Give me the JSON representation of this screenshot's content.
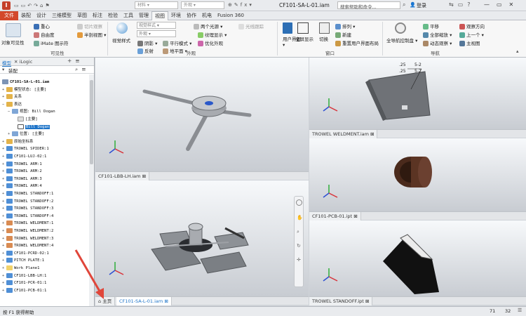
{
  "title": {
    "filename": "CF101-SA-L-01.iam",
    "search_placeholder": "搜索帮助和命令...",
    "login": "登录"
  },
  "ribbon_tabs": [
    "文件",
    "装配",
    "设计",
    "三维模型",
    "草图",
    "标注",
    "检验",
    "工具",
    "管理",
    "视图",
    "环境",
    "协作",
    "机电",
    "Fusion 360"
  ],
  "ribbon": {
    "visibility": {
      "big": "对象可见性",
      "center": "重心",
      "dof": "自由度",
      "imate": "iMate 图示符",
      "halfsection": "半剖视图",
      "slice": "切片观察",
      "panel": "可见性"
    },
    "appearance": {
      "visual_style": "视觉样式",
      "style_dd": "视觉样式",
      "appear_dd": "外观",
      "shadow": "阴影",
      "reflect": "反射",
      "parallel": "平行模式",
      "ground": "地平面",
      "lights": "两个光源",
      "texture": "纹理显示",
      "optimize": "优化外观",
      "raytrace": "光线跟踪",
      "panel": "外观"
    },
    "window": {
      "ui": "用户界面",
      "fullscreen": "全屏显示",
      "switch": "切换",
      "arrange": "排列",
      "new": "新建",
      "reset": "重置用户界面布局",
      "panel": "窗口"
    },
    "nav": {
      "bar": "全导航控制盘",
      "pan": "平移",
      "zoomall": "全部缩放",
      "orbit": "动态观察",
      "viewface": "观察方向",
      "prev": "上一个",
      "home": "主视图",
      "panel": "导航"
    }
  },
  "browser": {
    "tabs": [
      "模型",
      "iLogic"
    ],
    "header": "装配",
    "items": [
      "CF101-SA-L-01.iam",
      "模型状态: [主要]",
      "关系",
      "表达",
      "视图: Bill Dogan",
      "[主要]",
      "Bill Dogan",
      "位置: [主要]",
      "原始坐标系",
      "TROWEL SPIDER:1",
      "CF101-LUJ-02:1",
      "TROWEL ARM:1",
      "TROWEL ARM:2",
      "TROWEL ARM:3",
      "TROWEL ARM:4",
      "TROWEL STANDOFF:1",
      "TROWEL STANDOFF:2",
      "TROWEL STANDOFF:3",
      "TROWEL STANDOFF:4",
      "TROWEL WELDMENT:1",
      "TROWEL WELDMENT:2",
      "TROWEL WELDMENT:3",
      "TROWEL WELDMENT:4",
      "CF101-PCRD-02:1",
      "PITCH PLATE:1",
      "Work Plane1",
      "CF101-LBB-LH:1",
      "CF101-PCR-01:1",
      "CF101-PCB-01:1"
    ]
  },
  "viewports": {
    "v1": "CF101-LBB-LH.iam",
    "v2": "TROWEL WELDMENT.iam",
    "v3": "CF101-PCB-01.ipt",
    "v4_home": "主页",
    "v4": "CF101-SA-L-01.iam",
    "v5": "TROWEL STANDOFF.ipt"
  },
  "status": {
    "left": "按 F1 获得帮助",
    "n1": "71",
    "n2": "32"
  },
  "colors": {
    "accent": "#d3482b",
    "selection": "#1e74c8",
    "arrow": "#e0463a"
  }
}
